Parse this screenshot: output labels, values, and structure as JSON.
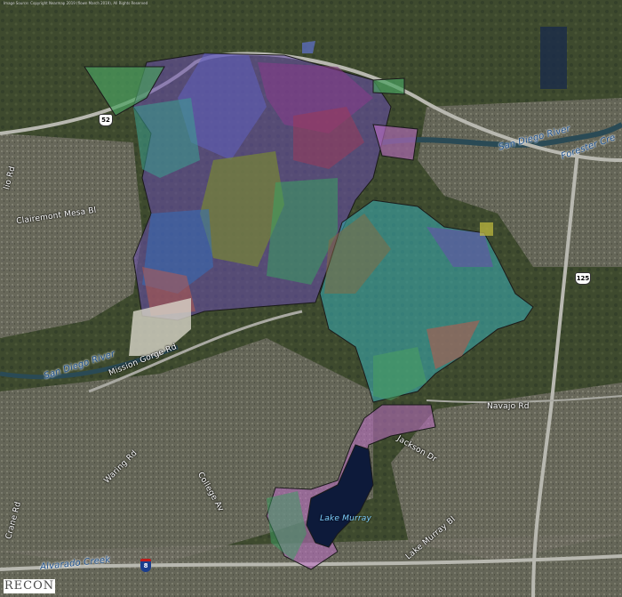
{
  "source_text": "Image Source: Copyright Nearmap 2019 (flown March 2019), All Rights Reserved",
  "logo": "RECON",
  "labels": {
    "road_clairemont_mesa": "Clairemont Mesa Bl",
    "road_lio": "lio Rd",
    "road_mission_gorge": "Mission Gorge Rd",
    "road_navajo": "Navajo Rd",
    "road_jackson": "Jackson Dr",
    "road_waring": "Waring Rd",
    "road_college": "College Av",
    "road_lake_murray": "Lake Murray Bl",
    "road_crane": "Crane Rd",
    "river_san_diego_west": "San Diego River",
    "river_san_diego_east": "San Diego River",
    "creek_forester": "Forester Cre",
    "creek_alvarado": "Alvarado Creek",
    "lake_murray": "Lake Murray"
  },
  "shields": {
    "sr52": "52",
    "sr125": "125",
    "i8": "8"
  },
  "colors": {
    "terrain_dark": "#3d4a30",
    "terrain_urban": "#6b6a60",
    "boundary": "#1a1a1a",
    "cyan_area": "#38b0b8",
    "purple_area": "#6a4fb0",
    "green_area": "#4aa060",
    "pink_area": "#c070c8",
    "lake": "#0d1a3a"
  }
}
